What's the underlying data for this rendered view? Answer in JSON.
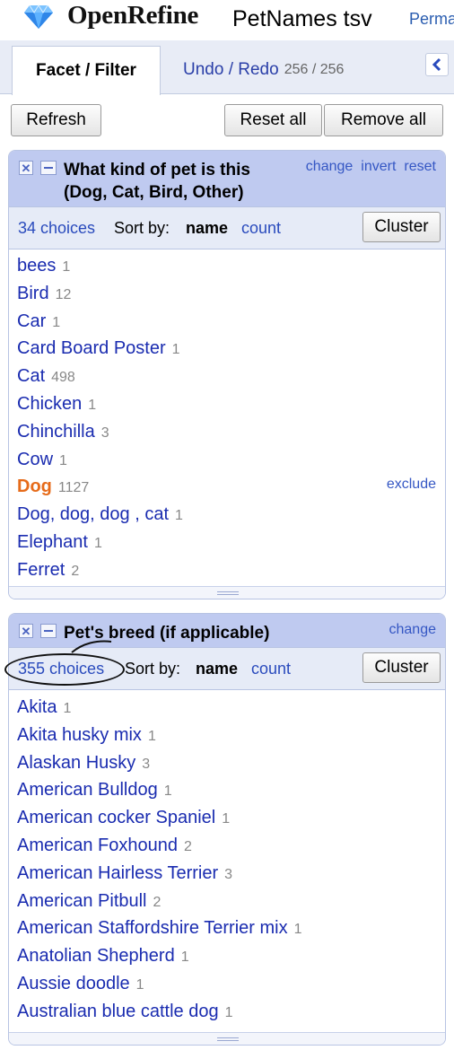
{
  "header": {
    "app_name": "OpenRefine",
    "project_name": "PetNames tsv",
    "permalink": "Perma"
  },
  "tabs": {
    "facet_filter": "Facet / Filter",
    "undo_redo": "Undo / Redo",
    "undo_count": "256 / 256"
  },
  "toolbar": {
    "refresh": "Refresh",
    "reset_all": "Reset all",
    "remove_all": "Remove all"
  },
  "facet1": {
    "title": "What kind of pet is this (Dog, Cat, Bird, Other)",
    "links": [
      "change",
      "invert",
      "reset"
    ],
    "choices_label": "34 choices",
    "sort_by": "Sort by:",
    "sort_name": "name",
    "sort_count": "count",
    "cluster": "Cluster",
    "exclude": "exclude",
    "items": [
      {
        "name": "bees",
        "count": "1"
      },
      {
        "name": "Bird",
        "count": "12"
      },
      {
        "name": "Car",
        "count": "1"
      },
      {
        "name": "Card Board Poster",
        "count": "1"
      },
      {
        "name": "Cat",
        "count": "498"
      },
      {
        "name": "Chicken",
        "count": "1"
      },
      {
        "name": "Chinchilla",
        "count": "3"
      },
      {
        "name": "Cow",
        "count": "1"
      },
      {
        "name": "Dog",
        "count": "1127",
        "selected": true
      },
      {
        "name": "Dog, dog, dog , cat",
        "count": "1"
      },
      {
        "name": "Elephant",
        "count": "1"
      },
      {
        "name": "Ferret",
        "count": "2"
      }
    ]
  },
  "facet2": {
    "title": "Pet's breed (if applicable)",
    "links": [
      "change"
    ],
    "choices_label": "355 choices",
    "sort_by": "Sort by:",
    "sort_name": "name",
    "sort_count": "count",
    "cluster": "Cluster",
    "items": [
      {
        "name": "Akita",
        "count": "1"
      },
      {
        "name": "Akita husky mix",
        "count": "1"
      },
      {
        "name": "Alaskan Husky",
        "count": "3"
      },
      {
        "name": "American Bulldog",
        "count": "1"
      },
      {
        "name": "American cocker Spaniel",
        "count": "1"
      },
      {
        "name": "American Foxhound",
        "count": "2"
      },
      {
        "name": "American Hairless Terrier",
        "count": "3"
      },
      {
        "name": "American Pitbull",
        "count": "2"
      },
      {
        "name": "American Staffordshire Terrier mix",
        "count": "1"
      },
      {
        "name": "Anatolian Shepherd",
        "count": "1"
      },
      {
        "name": "Aussie doodle",
        "count": "1"
      },
      {
        "name": "Australian blue cattle dog",
        "count": "1"
      }
    ]
  },
  "icons": {
    "logo": "diamond-logo-icon",
    "collapse": "chevron-left-icon",
    "remove": "close-icon",
    "minimize": "minimize-icon"
  },
  "colors": {
    "link": "#2a4bbd",
    "selected": "#e66b1a",
    "facet_header": "#bfcaf0"
  }
}
